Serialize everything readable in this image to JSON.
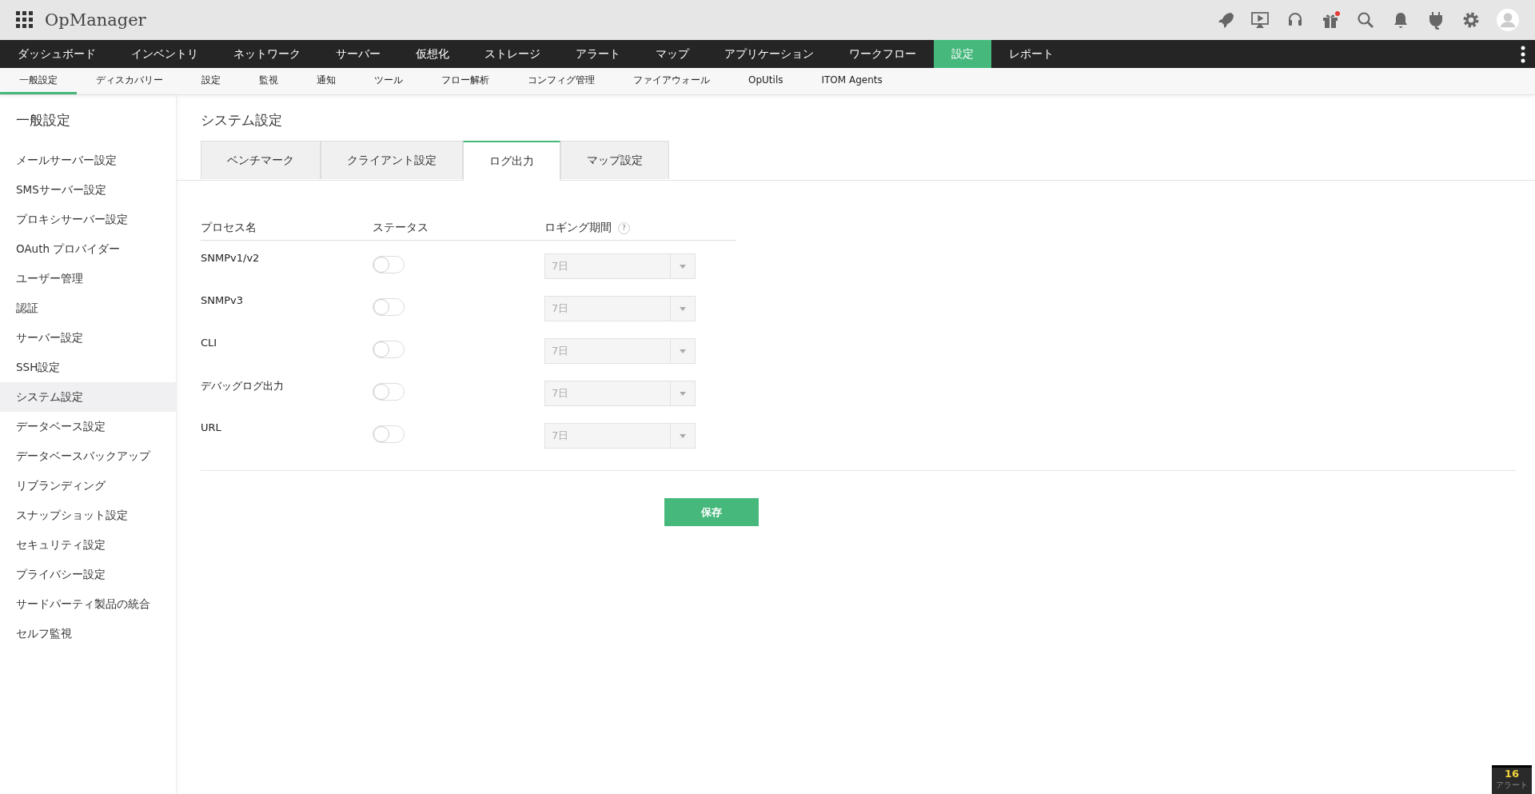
{
  "header": {
    "app_name": "OpManager",
    "gift_has_notification": true
  },
  "main_nav": [
    {
      "label": "ダッシュボード",
      "selected": false
    },
    {
      "label": "インベントリ",
      "selected": false
    },
    {
      "label": "ネットワーク",
      "selected": false
    },
    {
      "label": "サーバー",
      "selected": false
    },
    {
      "label": "仮想化",
      "selected": false
    },
    {
      "label": "ストレージ",
      "selected": false
    },
    {
      "label": "アラート",
      "selected": false
    },
    {
      "label": "マップ",
      "selected": false
    },
    {
      "label": "アプリケーション",
      "selected": false
    },
    {
      "label": "ワークフロー",
      "selected": false
    },
    {
      "label": "設定",
      "selected": true
    },
    {
      "label": "レポート",
      "selected": false
    }
  ],
  "sub_nav": [
    {
      "label": "一般設定",
      "selected": true
    },
    {
      "label": "ディスカバリー",
      "selected": false
    },
    {
      "label": "設定",
      "selected": false
    },
    {
      "label": "監視",
      "selected": false
    },
    {
      "label": "通知",
      "selected": false
    },
    {
      "label": "ツール",
      "selected": false
    },
    {
      "label": "フロー解析",
      "selected": false
    },
    {
      "label": "コンフィグ管理",
      "selected": false
    },
    {
      "label": "ファイアウォール",
      "selected": false
    },
    {
      "label": "OpUtils",
      "selected": false
    },
    {
      "label": "ITOM Agents",
      "selected": false
    }
  ],
  "sidebar": {
    "title": "一般設定",
    "items": [
      {
        "label": "メールサーバー設定",
        "selected": false
      },
      {
        "label": "SMSサーバー設定",
        "selected": false
      },
      {
        "label": "プロキシサーバー設定",
        "selected": false
      },
      {
        "label": "OAuth プロバイダー",
        "selected": false
      },
      {
        "label": "ユーザー管理",
        "selected": false
      },
      {
        "label": "認証",
        "selected": false
      },
      {
        "label": "サーバー設定",
        "selected": false
      },
      {
        "label": "SSH設定",
        "selected": false
      },
      {
        "label": "システム設定",
        "selected": true
      },
      {
        "label": "データベース設定",
        "selected": false
      },
      {
        "label": "データベースバックアップ",
        "selected": false
      },
      {
        "label": "リブランディング",
        "selected": false
      },
      {
        "label": "スナップショット設定",
        "selected": false
      },
      {
        "label": "セキュリティ設定",
        "selected": false
      },
      {
        "label": "プライバシー設定",
        "selected": false
      },
      {
        "label": "サードパーティ製品の統合",
        "selected": false
      },
      {
        "label": "セルフ監視",
        "selected": false
      }
    ]
  },
  "page_title": "システム設定",
  "tabs": [
    {
      "label": "ベンチマーク",
      "selected": false
    },
    {
      "label": "クライアント設定",
      "selected": false
    },
    {
      "label": "ログ出力",
      "selected": true
    },
    {
      "label": "マップ設定",
      "selected": false
    }
  ],
  "table": {
    "columns": [
      "プロセス名",
      "ステータス",
      "ロギング期間"
    ],
    "help": "?",
    "rows": [
      {
        "process": "SNMPv1/v2",
        "on": false,
        "period": "7日",
        "disabled": true
      },
      {
        "process": "SNMPv3",
        "on": false,
        "period": "7日",
        "disabled": true
      },
      {
        "process": "CLI",
        "on": false,
        "period": "7日",
        "disabled": true
      },
      {
        "process": "デバッグログ出力",
        "on": false,
        "period": "7日",
        "disabled": true
      },
      {
        "process": "URL",
        "on": false,
        "period": "7日",
        "disabled": true
      }
    ]
  },
  "save_button": "保存",
  "alarm_badge": {
    "count": "16",
    "label": "アラート"
  }
}
